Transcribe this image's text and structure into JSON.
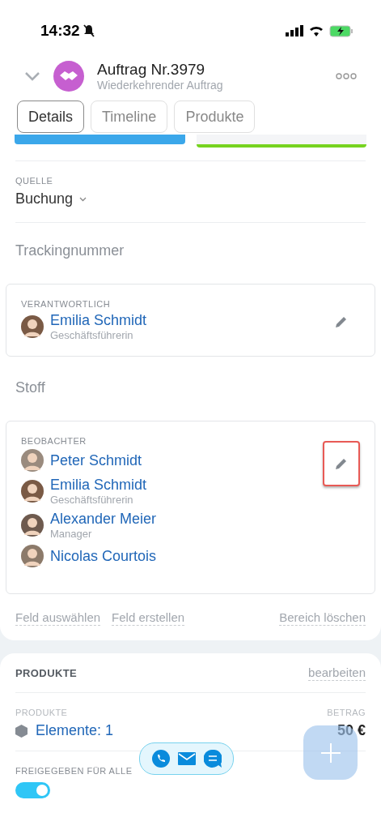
{
  "status_bar": {
    "time": "14:32"
  },
  "header": {
    "title": "Auftrag Nr.3979",
    "subtitle": "Wiederkehrender Auftrag"
  },
  "tabs": [
    {
      "label": "Details",
      "selected": true
    },
    {
      "label": "Timeline",
      "selected": false
    },
    {
      "label": "Produkte",
      "selected": false
    }
  ],
  "stages": [
    {
      "color": "#3ba7ea"
    },
    {
      "color": "#76d320"
    }
  ],
  "source": {
    "label": "QUELLE",
    "value": "Buchung"
  },
  "tracking": {
    "placeholder": "Trackingnummer"
  },
  "responsible": {
    "label": "VERANTWORTLICH",
    "people": [
      {
        "name": "Emilia Schmidt",
        "role": "Geschäftsführerin"
      }
    ]
  },
  "material": {
    "placeholder": "Stoff"
  },
  "observers": {
    "label": "BEOBACHTER",
    "highlighted": true,
    "people": [
      {
        "name": "Peter Schmidt"
      },
      {
        "name": "Emilia Schmidt",
        "role": "Geschäftsführerin"
      },
      {
        "name": "Alexander Meier",
        "role": "Manager"
      },
      {
        "name": "Nicolas Courtois"
      }
    ]
  },
  "section_actions": [
    "Feld auswählen",
    "Feld erstellen",
    "Bereich löschen"
  ],
  "products": {
    "title": "PRODUKTE",
    "edit": "bearbeiten",
    "column_1": "PRODUKTE",
    "column_2": "BETRAG",
    "items": "Elemente: 1",
    "amount": "50 €"
  },
  "shared": {
    "label": "FREIGEGEBEN FÜR ALLE",
    "on": true
  }
}
